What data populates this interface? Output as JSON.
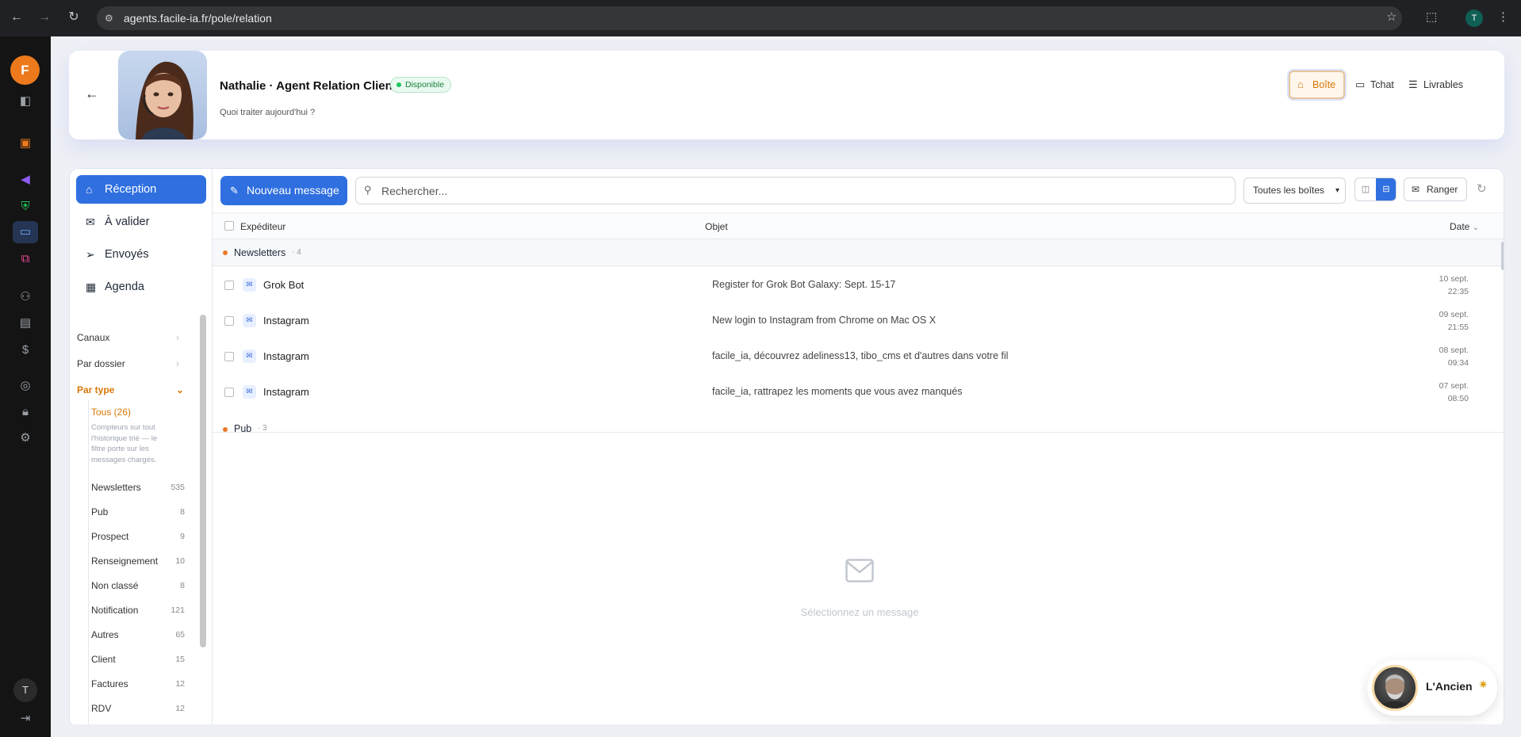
{
  "browser": {
    "url": "agents.facile-ia.fr/pole/relation",
    "profile_initial": "T"
  },
  "rail": {
    "logo": "F",
    "user_initial": "T",
    "icons": [
      "sidebar-toggle-icon",
      "robot-icon",
      "megaphone-icon",
      "shield-icon",
      "chat-icon",
      "link-icon",
      "users-icon",
      "board-icon",
      "dollar-icon",
      "compass-icon",
      "lock-icon",
      "settings-icon",
      "logout-icon"
    ]
  },
  "header": {
    "name": "Nathalie · Agent Relation Client",
    "status": "Disponible",
    "subtitle": "Quoi traiter aujourd'hui ?",
    "buttons": [
      {
        "label": "Boîte",
        "icon": "inbox-icon",
        "active": true
      },
      {
        "label": "Tchat",
        "icon": "chat-icon",
        "active": false
      },
      {
        "label": "Livrables",
        "icon": "checklist-icon",
        "active": false
      }
    ]
  },
  "sidebar": {
    "nav": [
      {
        "label": "Réception",
        "icon": "inbox-icon",
        "active": true
      },
      {
        "label": "À valider",
        "icon": "mail-icon",
        "active": false
      },
      {
        "label": "Envoyés",
        "icon": "send-icon",
        "active": false
      },
      {
        "label": "Agenda",
        "icon": "calendar-icon",
        "active": false
      }
    ],
    "filters": [
      {
        "label": "Canaux",
        "open": false
      },
      {
        "label": "Par dossier",
        "open": false
      },
      {
        "label": "Par type",
        "open": true
      }
    ],
    "all_label": "Tous (26)",
    "note": "Compteurs sur tout l'historique trié — le filtre porte sur les messages chargés.",
    "categories": [
      {
        "label": "Newsletters",
        "count": "535"
      },
      {
        "label": "Pub",
        "count": "8"
      },
      {
        "label": "Prospect",
        "count": "9"
      },
      {
        "label": "Renseignement",
        "count": "10"
      },
      {
        "label": "Non classé",
        "count": "8"
      },
      {
        "label": "Notification",
        "count": "121"
      },
      {
        "label": "Autres",
        "count": "65"
      },
      {
        "label": "Client",
        "count": "15"
      },
      {
        "label": "Factures",
        "count": "12"
      },
      {
        "label": "RDV",
        "count": "12"
      }
    ]
  },
  "toolbar": {
    "new_message": "Nouveau message",
    "search_placeholder": "Rechercher...",
    "mailbox_select": "Toutes les boîtes",
    "ranger": "Ranger"
  },
  "table": {
    "col_sender": "Expéditeur",
    "col_subject": "Objet",
    "col_date": "Date",
    "groups": [
      {
        "name": "Newsletters",
        "count": "· 4"
      },
      {
        "name": "Pub",
        "count": "· 3"
      }
    ],
    "rows": [
      {
        "sender": "Grok Bot",
        "subject": "Register for Grok Bot Galaxy: Sept. 15-17",
        "date": "10 sept.",
        "time": "22:35"
      },
      {
        "sender": "Instagram",
        "subject": "New login to Instagram from Chrome on Mac OS X",
        "date": "09 sept.",
        "time": "21:55"
      },
      {
        "sender": "Instagram",
        "subject": "facile_ia, découvrez adeliness13, tibo_cms et d'autres dans votre fil",
        "date": "08 sept.",
        "time": "09:34"
      },
      {
        "sender": "Instagram",
        "subject": "facile_ia, rattrapez les moments que vous avez manqués",
        "date": "07 sept.",
        "time": "08:50"
      }
    ]
  },
  "preview": {
    "empty_text": "Sélectionnez un message"
  },
  "assistant": {
    "label": "L'Ancien"
  }
}
